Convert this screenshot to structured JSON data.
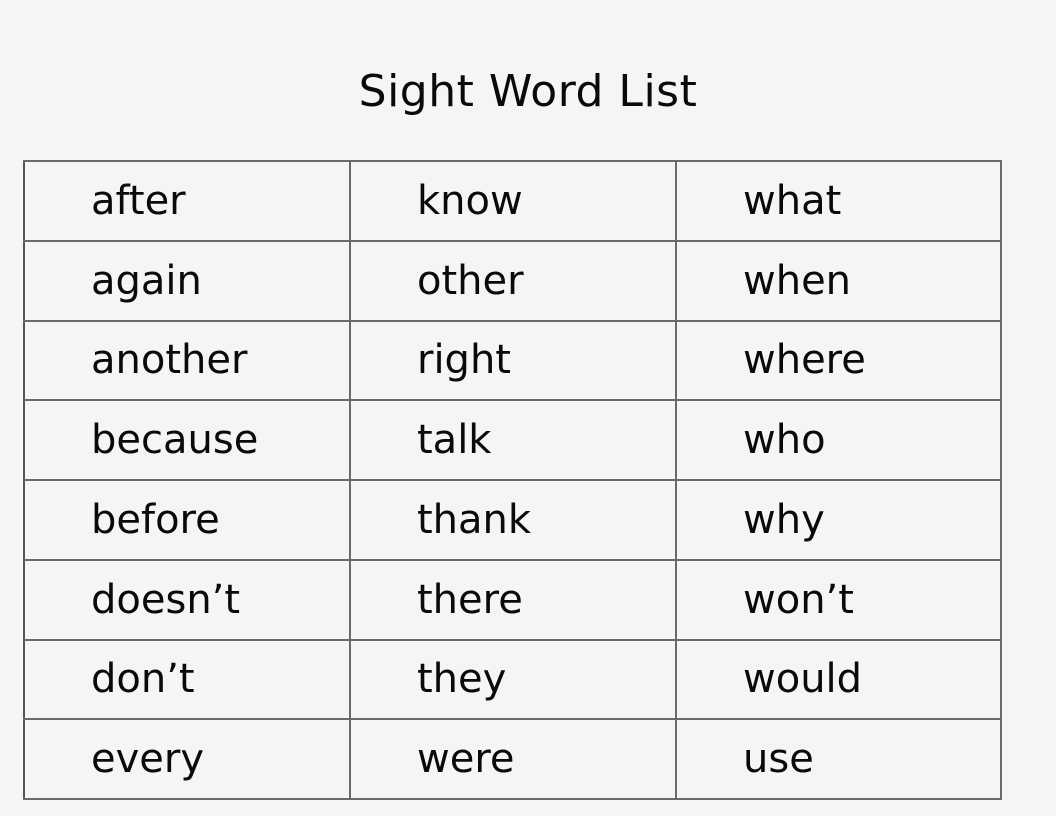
{
  "title": "Sight Word List",
  "table": {
    "rows": [
      [
        "after",
        "know",
        "what"
      ],
      [
        "again",
        "other",
        "when"
      ],
      [
        "another",
        "right",
        "where"
      ],
      [
        "because",
        "talk",
        "who"
      ],
      [
        "before",
        "thank",
        "why"
      ],
      [
        "doesn’t",
        "there",
        "won’t"
      ],
      [
        "don’t",
        "they",
        "would"
      ],
      [
        "every",
        "were",
        "use"
      ]
    ]
  }
}
